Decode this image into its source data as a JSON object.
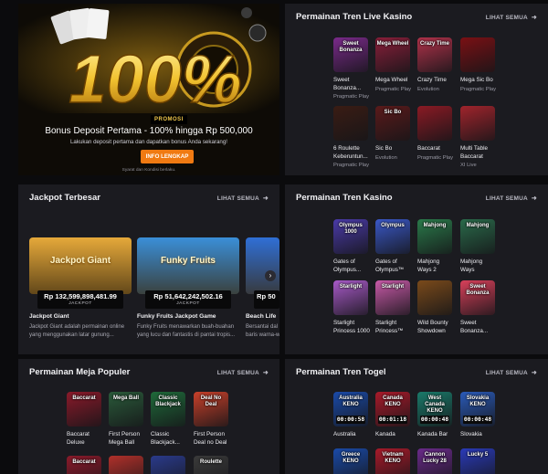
{
  "promo": {
    "badge": "PROMOSI",
    "title": "Bonus Deposit Pertama - 100% hingga Rp 500,000",
    "description": "Lakukan deposit pertama dan dapatkan bonus Anda sekarang!",
    "button": "INFO LENGKAP",
    "terms": "Syarat dan Kondisi berlaku.",
    "art_text": "100%"
  },
  "see_all": "LIHAT SEMUA",
  "live_casino": {
    "title": "Permainan Tren Live Kasino",
    "games": [
      {
        "name": [
          "Sweet",
          "Bonanza..."
        ],
        "provider": "Pragmatic Play",
        "art": "Sweet Bonanza",
        "color": "#7a2a8a"
      },
      {
        "name": [
          "Mega Wheel"
        ],
        "provider": "Pragmatic Play",
        "art": "Mega Wheel",
        "color": "#8a1f3a"
      },
      {
        "name": [
          "Crazy Time"
        ],
        "provider": "Evolution",
        "art": "Crazy Time",
        "color": "#b0324a"
      },
      {
        "name": [
          "Mega Sic Bo"
        ],
        "provider": "Pragmatic Play",
        "art": "",
        "color": "#7a1014"
      },
      {
        "name": [
          "6 Roulette",
          "Keberuntun..."
        ],
        "provider": "Pragmatic Play",
        "art": "",
        "color": "#3a1c14"
      },
      {
        "name": [
          "Sic Bo"
        ],
        "provider": "Evolution",
        "art": "Sic Bo",
        "color": "#5a1a1a"
      },
      {
        "name": [
          "Baccarat"
        ],
        "provider": "Pragmatic Play",
        "art": "",
        "color": "#8a1a24"
      },
      {
        "name": [
          "Multi Table",
          "Baccarat"
        ],
        "provider": "XI Live",
        "art": "",
        "color": "#a0242c"
      }
    ]
  },
  "jackpot": {
    "title": "Jackpot Terbesar",
    "items": [
      {
        "art": "Jackpot Giant",
        "amount": "Rp 132,599,898,481.99",
        "label": "JACKPOT",
        "name": "Jackpot Giant",
        "desc": [
          "Jackpot Giant adalah permainan online",
          "yang menggunakan latar gunung..."
        ],
        "color": "#e6a93a"
      },
      {
        "art": "Funky Fruits",
        "amount": "Rp 51,642,242,502.16",
        "label": "JACKPOT",
        "name": "Funky Fruits Jackpot Game",
        "desc": [
          "Funky Fruits menawarkan buah-buahan",
          "yang lucu dan fantastis di pantai tropis..."
        ],
        "color": "#3a8fd8"
      },
      {
        "art": "",
        "amount": "Rp 50",
        "label": "",
        "name": "Beach Life",
        "desc": [
          "Bersantai dal",
          "baris warna-w"
        ],
        "color": "#2f6fd6"
      }
    ]
  },
  "casino": {
    "title": "Permainan Tren Kasino",
    "games": [
      {
        "name": [
          "Gates of",
          "Olympus..."
        ],
        "art": "Olympus 1000",
        "color": "#4a3aa8"
      },
      {
        "name": [
          "Gates of",
          "Olympus™"
        ],
        "art": "Olympus",
        "color": "#3a58c8"
      },
      {
        "name": [
          "Mahjong",
          "Ways 2"
        ],
        "art": "Mahjong",
        "color": "#2a7a4a"
      },
      {
        "name": [
          "Mahjong",
          "Ways"
        ],
        "art": "Mahjong",
        "color": "#2a6a4a"
      },
      {
        "name": [
          "Starlight",
          "Princess 1000"
        ],
        "art": "Starlight",
        "color": "#a85ac8"
      },
      {
        "name": [
          "Starlight",
          "Princess™"
        ],
        "art": "Starlight",
        "color": "#c85aa8"
      },
      {
        "name": [
          "Wild Bounty",
          "Showdown"
        ],
        "art": "",
        "color": "#7a4a1a"
      },
      {
        "name": [
          "Sweet",
          "Bonanza..."
        ],
        "art": "Sweet Bonanza",
        "color": "#d8405a"
      }
    ]
  },
  "table": {
    "title": "Permainan Meja Populer",
    "games": [
      {
        "name": [
          "Baccarat",
          "Deluxe"
        ],
        "art": "Baccarat",
        "color": "#8a1a2a"
      },
      {
        "name": [
          "First Person",
          "Mega Ball"
        ],
        "art": "Mega Ball",
        "color": "#2a5a3a"
      },
      {
        "name": [
          "Classic",
          "Blackjack..."
        ],
        "art": "Classic Blackjack",
        "color": "#1f6a3a"
      },
      {
        "name": [
          "First Person",
          "Deal no Deal"
        ],
        "art": "Deal No Deal",
        "color": "#c8402a"
      }
    ],
    "row2": [
      "Baccarat",
      "",
      "",
      "Roulette"
    ]
  },
  "togel": {
    "title": "Permainan Tren Togel",
    "games": [
      {
        "name": "Australia",
        "art": "Australia KENO",
        "time": "00:00:58",
        "color": "#1a4aa8"
      },
      {
        "name": "Kanada",
        "art": "Canada KENO",
        "time": "00:01:18",
        "color": "#a81a2a"
      },
      {
        "name": "Kanada Bar",
        "art": "West Canada KENO",
        "time": "00:00:48",
        "color": "#1a7a6a"
      },
      {
        "name": "Slovakia",
        "art": "Slovakia KENO",
        "time": "00:00:48",
        "color": "#2a5ab8"
      }
    ],
    "row2": [
      "Greece KENO",
      "Vietnam KENO",
      "Cannon Lucky 28",
      "Lucky 5"
    ]
  }
}
